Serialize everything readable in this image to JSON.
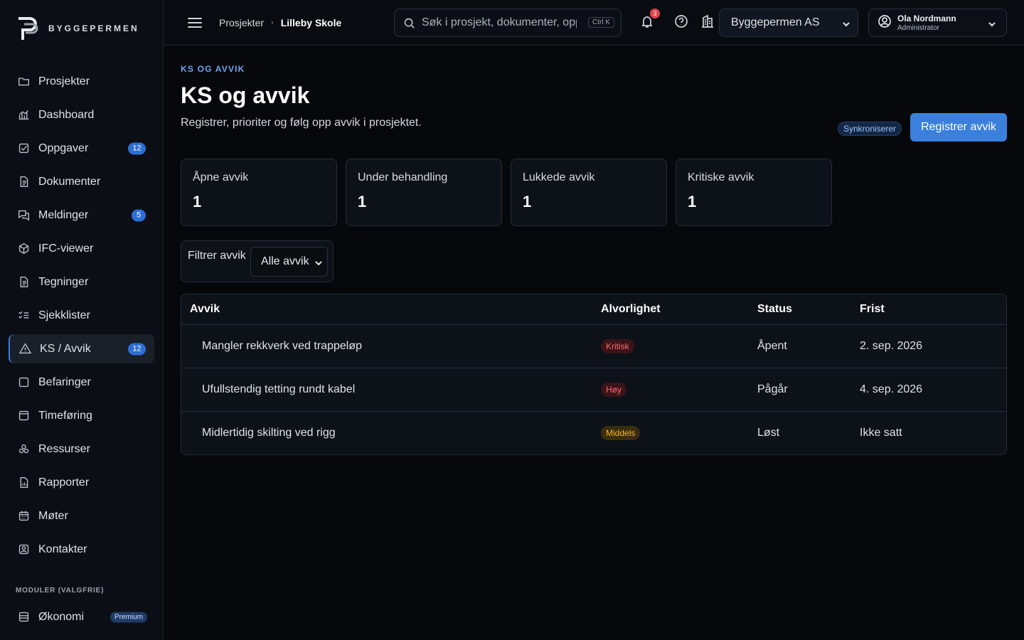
{
  "brand": {
    "name": "BYGGEPERMEN"
  },
  "sidebar": {
    "items": [
      {
        "label": "Prosjekter",
        "icon": "folder-icon",
        "badge": ""
      },
      {
        "label": "Dashboard",
        "icon": "chart-icon",
        "badge": ""
      },
      {
        "label": "Oppgaver",
        "icon": "checkbox-icon",
        "badge": "12"
      },
      {
        "label": "Dokumenter",
        "icon": "document-icon",
        "badge": ""
      },
      {
        "label": "Meldinger",
        "icon": "chat-icon",
        "badge": "5"
      },
      {
        "label": "IFC-viewer",
        "icon": "cube-icon",
        "badge": ""
      },
      {
        "label": "Tegninger",
        "icon": "drawing-icon",
        "badge": ""
      },
      {
        "label": "Sjekklister",
        "icon": "checklist-icon",
        "badge": ""
      },
      {
        "label": "KS / Avvik",
        "icon": "warning-icon",
        "badge": "12",
        "active": true
      },
      {
        "label": "Befaringer",
        "icon": "inspection-icon",
        "badge": ""
      },
      {
        "label": "Timeføring",
        "icon": "timesheet-icon",
        "badge": ""
      },
      {
        "label": "Ressurser",
        "icon": "resources-icon",
        "badge": ""
      },
      {
        "label": "Rapporter",
        "icon": "report-icon",
        "badge": ""
      },
      {
        "label": "Møter",
        "icon": "calendar-icon",
        "badge": ""
      },
      {
        "label": "Kontakter",
        "icon": "contact-icon",
        "badge": ""
      }
    ],
    "modules_label": "MODULER (VALGFRIE)",
    "modules": [
      {
        "label": "Økonomi",
        "icon": "finance-icon",
        "tag": "Premium"
      }
    ]
  },
  "topbar": {
    "breadcrumb": [
      "Prosjekter",
      "Lilleby Skole"
    ],
    "search_placeholder": "Søk i prosjekt, dokumenter, oppgaver",
    "search_shortcut": "Ctrl K",
    "notifications_count": "3",
    "company": "Byggepermen AS",
    "user_name": "Ola Nordmann",
    "user_role": "Administrator"
  },
  "page": {
    "eyebrow": "KS OG AVVIK",
    "title": "KS og avvik",
    "subtitle": "Registrer, prioriter og følg opp avvik i prosjektet.",
    "sync_label": "Synkroniserer",
    "primary_action": "Registrer avvik"
  },
  "stats": [
    {
      "label": "Åpne avvik",
      "value": "1"
    },
    {
      "label": "Under behandling",
      "value": "1"
    },
    {
      "label": "Lukkede avvik",
      "value": "1"
    },
    {
      "label": "Kritiske avvik",
      "value": "1"
    }
  ],
  "filter": {
    "label": "Filtrer avvik",
    "selected": "Alle avvik"
  },
  "table": {
    "headers": [
      "Avvik",
      "Alvorlighet",
      "Status",
      "Frist"
    ],
    "rows": [
      {
        "title": "Mangler rekkverk ved trappeløp",
        "severity": "Kritisk",
        "status": "Åpent",
        "deadline": "2. sep. 2026"
      },
      {
        "title": "Ufullstendig tetting rundt kabel",
        "severity": "Høy",
        "status": "Pågår",
        "deadline": "4. sep. 2026"
      },
      {
        "title": "Midlertidig skilting ved rigg",
        "severity": "Middels",
        "status": "Løst",
        "deadline": "Ikke satt"
      }
    ]
  },
  "colors": {
    "accent": "#3a80dc",
    "critical": "#ff6a6f",
    "medium": "#f0b429",
    "background": "#06080c"
  }
}
